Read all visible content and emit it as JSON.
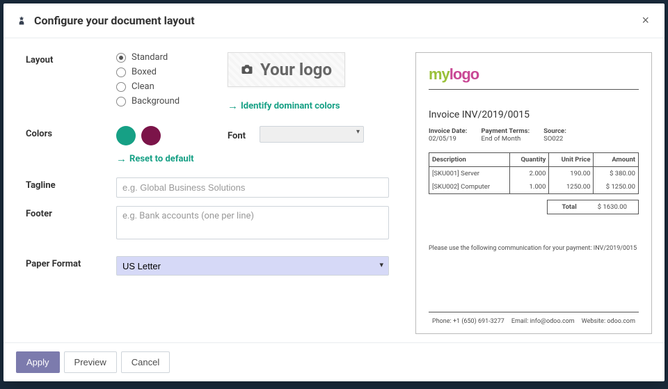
{
  "modal": {
    "title": "Configure your document layout",
    "close": "×"
  },
  "form": {
    "layout": {
      "label": "Layout",
      "options": [
        {
          "label": "Standard",
          "checked": true
        },
        {
          "label": "Boxed",
          "checked": false
        },
        {
          "label": "Clean",
          "checked": false
        },
        {
          "label": "Background",
          "checked": false
        }
      ]
    },
    "logo_placeholder": "Your logo",
    "identify_colors": "Identify dominant colors",
    "colors": {
      "label": "Colors",
      "swatches": [
        "#16a085",
        "#7b1449"
      ],
      "reset": "Reset to default"
    },
    "font": {
      "label": "Font",
      "value": ""
    },
    "tagline": {
      "label": "Tagline",
      "placeholder": "e.g. Global Business Solutions"
    },
    "footer": {
      "label": "Footer",
      "placeholder": "e.g. Bank accounts (one per line)"
    },
    "paper": {
      "label": "Paper Format",
      "value": "US Letter"
    }
  },
  "preview": {
    "logo_a": "my",
    "logo_b": "logo",
    "invoice_title": "Invoice INV/2019/0015",
    "meta": {
      "date_label": "Invoice Date:",
      "date_value": "02/05/19",
      "terms_label": "Payment Terms:",
      "terms_value": "End of Month",
      "source_label": "Source:",
      "source_value": "SO022"
    },
    "table": {
      "headers": {
        "desc": "Description",
        "qty": "Quantity",
        "price": "Unit Price",
        "amount": "Amount"
      },
      "rows": [
        {
          "desc": "[SKU001] Server",
          "qty": "2.000",
          "price": "190.00",
          "amount": "$ 380.00"
        },
        {
          "desc": "[SKU002] Computer",
          "qty": "1.000",
          "price": "1250.00",
          "amount": "$ 1250.00"
        }
      ],
      "total_label": "Total",
      "total_value": "$ 1630.00"
    },
    "communication": "Please use the following communication for your payment: INV/2019/0015",
    "footer": {
      "phone": "Phone: +1 (650) 691-3277",
      "email": "Email: info@odoo.com",
      "website": "Website: odoo.com"
    }
  },
  "buttons": {
    "apply": "Apply",
    "preview": "Preview",
    "cancel": "Cancel"
  }
}
